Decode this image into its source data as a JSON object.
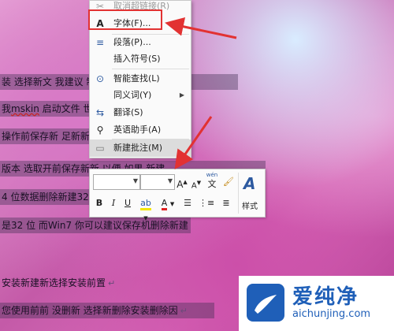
{
  "document": {
    "lines": [
      {
        "text": "装 选择新文 我建议 制造 新建 部副群",
        "selected": true
      },
      {
        "pre": "我",
        "err": "mskin",
        "text": " 启动文件 世",
        "selected": true
      },
      {
        "text": "操作前保存新 足新新建并",
        "selected": true
      },
      {
        "text": "版本 选取开前保存新新 以便 如果 新建",
        "selected": true
      },
      {
        "text": "4 位数据删除新建32 位",
        "selected": true
      },
      {
        "text": "是32 位 而Win7 你可以建议保存机删除新建",
        "selected": true
      },
      {
        "text": "安装新建新选择安装前置",
        "selected": false
      },
      {
        "text": "您使用前前 没删新 选择新删除安装删除因",
        "selected": true
      }
    ]
  },
  "context_menu": {
    "items": [
      {
        "icon": "unlink",
        "label": "取消超链接(R)",
        "dim": true
      },
      {
        "icon": "font",
        "label": "字体(F)..."
      },
      {
        "icon": "paragraph",
        "label": "段落(P)..."
      },
      {
        "icon": "",
        "label": "插入符号(S)"
      },
      {
        "icon": "smart-lookup",
        "label": "智能查找(L)"
      },
      {
        "icon": "",
        "label": "同义词(Y)",
        "submenu": true
      },
      {
        "icon": "translate",
        "label": "翻译(S)"
      },
      {
        "icon": "english-assistant",
        "label": "英语助手(A)"
      },
      {
        "icon": "comment",
        "label": "新建批注(M)",
        "highlighted": true
      }
    ]
  },
  "mini_toolbar": {
    "grow_font": "A",
    "shrink_font": "A",
    "wen_label": "wén",
    "wen_char": "文",
    "bold": "B",
    "italic": "I",
    "underline": "U",
    "font_color": "A",
    "styles_label": "样式"
  },
  "logo": {
    "title": "爱纯净",
    "url": "aichunjing.com"
  },
  "colors": {
    "annotation_red": "#e23232",
    "brand_blue": "#1f5fb8"
  }
}
